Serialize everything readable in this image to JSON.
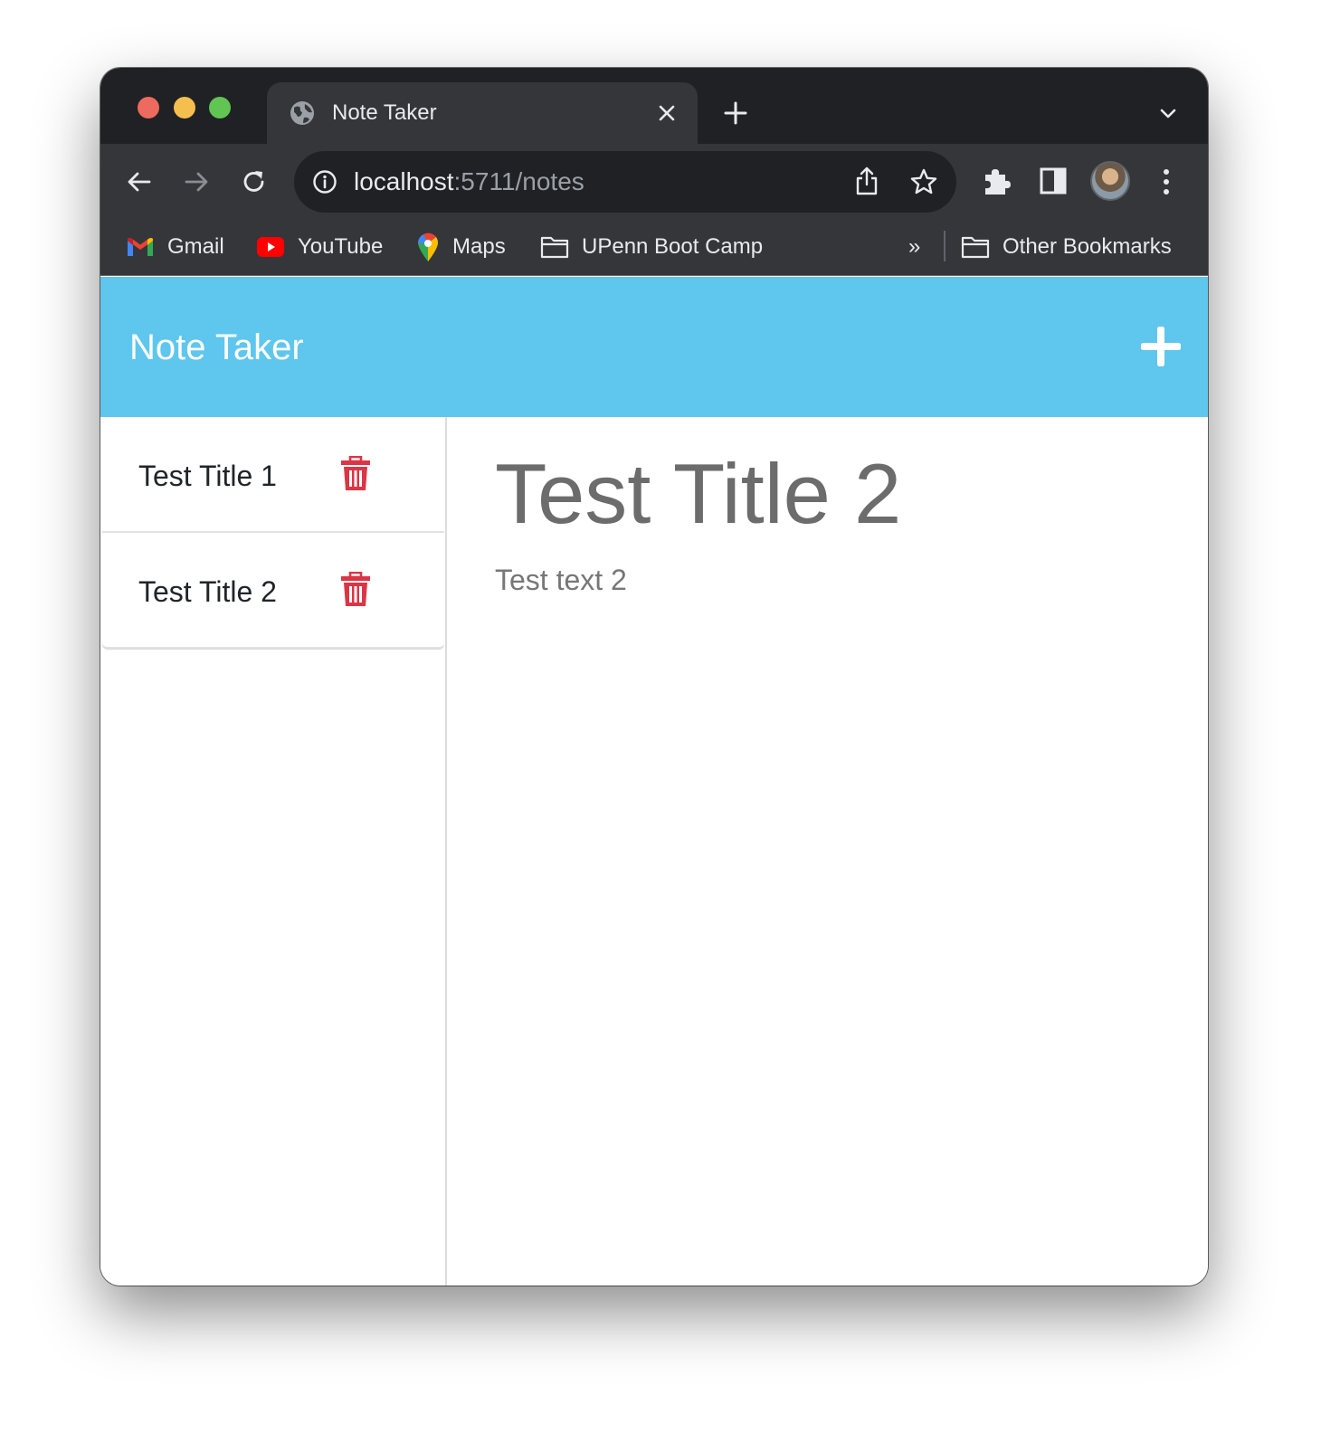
{
  "browser": {
    "tab_title": "Note Taker",
    "url_host": "localhost",
    "url_rest": ":5711/notes",
    "bookmarks": [
      {
        "label": "Gmail",
        "icon": "gmail-icon"
      },
      {
        "label": "YouTube",
        "icon": "youtube-icon"
      },
      {
        "label": "Maps",
        "icon": "maps-icon"
      },
      {
        "label": "UPenn Boot Camp",
        "icon": "folder-icon"
      }
    ],
    "bookmarks_overflow": "»",
    "other_bookmarks": "Other Bookmarks"
  },
  "app": {
    "title": "Note Taker",
    "header_color": "#5fc6ed",
    "notes": [
      {
        "title": "Test Title 1"
      },
      {
        "title": "Test Title 2"
      }
    ],
    "active_note": {
      "title": "Test Title 2",
      "text": "Test text 2"
    },
    "delete_color": "#dc3545"
  }
}
